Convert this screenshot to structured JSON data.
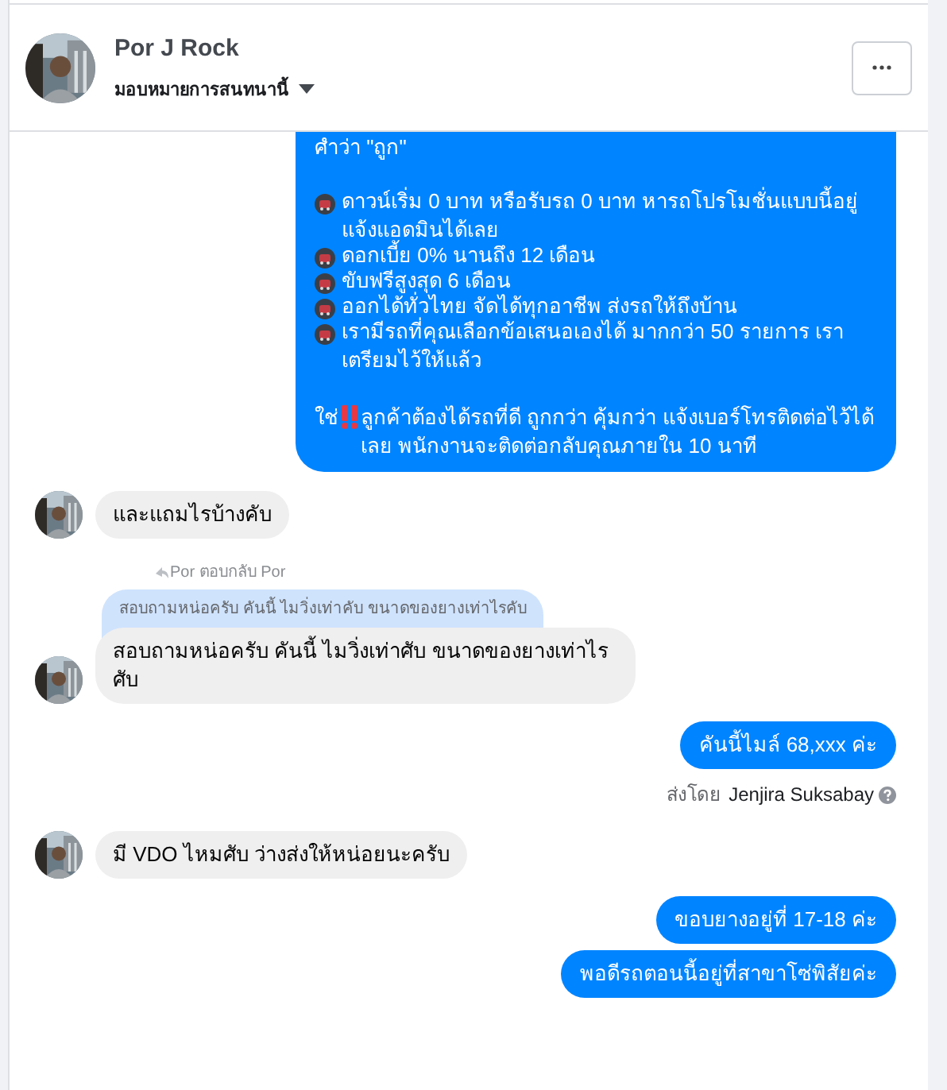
{
  "header": {
    "name": "Por J Rock",
    "assign_label": "มอบหมายการสนทนานี้"
  },
  "messages": [
    {
      "kind": "outgoing_rich",
      "paragraphs": [
        {
          "kind": "plain",
          "text": "ศำว่า \"ถูก\""
        },
        {
          "kind": "gap"
        },
        {
          "kind": "car",
          "text": "ดาวน์เริ่ม 0 บาท หรือรับรถ 0 บาท หารถโปรโมชั่นแบบนี้อยู่ แจ้งแอดมินได้เลย"
        },
        {
          "kind": "car",
          "text": "ดอกเบี้ย 0% นานถึง 12 เดือน"
        },
        {
          "kind": "car",
          "text": "ขับฟรีสูงสุด 6 เดือน"
        },
        {
          "kind": "car",
          "text": "ออกได้ทั่วไทย จัดได้ทุกอาชีพ ส่งรถให้ถึงบ้าน"
        },
        {
          "kind": "car",
          "text": "เรามีรถที่คุณเลือกข้อเสนอเองได้ มากกว่า 50 รายการ เราเตรียมไว้ให้แล้ว"
        },
        {
          "kind": "gap"
        },
        {
          "kind": "alert",
          "before": "ใช่",
          "text": "ลูกค้าต้องได้รถที่ดี ถูกกว่า คุ้มกว่า แจ้งเบอร์โทรติดต่อไว้ได้เลย พนักงานจะติดต่อกลับคุณภายใน 10 นาที"
        }
      ]
    },
    {
      "kind": "incoming",
      "text": "และแถมไรบ้างคับ"
    },
    {
      "kind": "incoming_reply",
      "reply_label": "Por ตอบกลับ Por",
      "quote": "สอบถามหน่อครับ คันนี้ ไมวิ่งเท่าคับ ขนาดของยางเท่าไรคับ",
      "text": "สอบถามหน่อครับ คันนี้ ไมวิ่งเท่าศับ ขนาดของยางเท่าไร ศับ"
    },
    {
      "kind": "outgoing",
      "texts": [
        "คันนี้ไมล์ 68,xxx ค่ะ"
      ],
      "sent_by_label": "ส่งโดย",
      "sender": "Jenjira Suksabay"
    },
    {
      "kind": "incoming",
      "text": "มี VDO ไหมศับ  ว่างส่งให้หน่อยนะครับ"
    },
    {
      "kind": "outgoing",
      "texts": [
        "ขอบยางอยู่ที่ 17-18 ค่ะ",
        "พอดีรถตอนนี้อยู่ที่สาขาโซ่พิสัยค่ะ"
      ]
    }
  ]
}
